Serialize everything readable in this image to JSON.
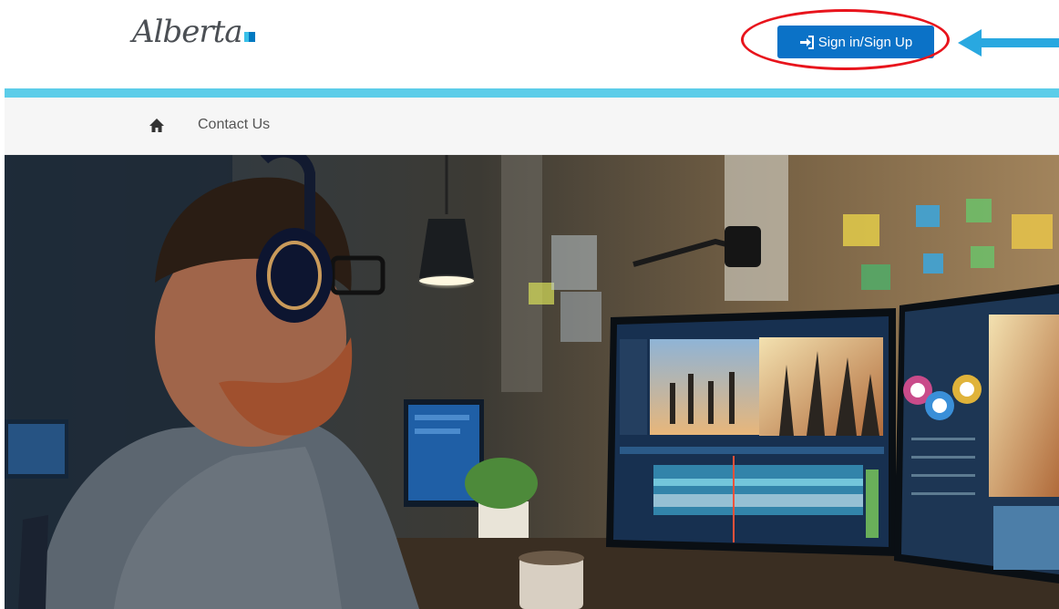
{
  "header": {
    "logo_text": "Alberta",
    "signin_label": "Sign in/Sign Up"
  },
  "nav": {
    "items": [
      {
        "label": "Contact Us"
      }
    ]
  },
  "annotations": {
    "highlight_color": "#e8141c",
    "arrow_color": "#29a8e0"
  },
  "colors": {
    "accent_bar": "#5ccde9",
    "button": "#0b72c7",
    "logo_blue": "#0079c1"
  }
}
